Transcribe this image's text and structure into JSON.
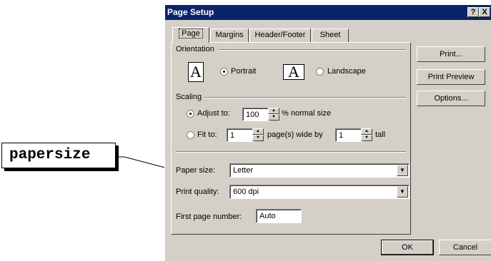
{
  "callout": {
    "text": "papersize"
  },
  "dialog": {
    "title": "Page Setup",
    "help_label": "?",
    "close_label": "X",
    "tabs": [
      "Page",
      "Margins",
      "Header/Footer",
      "Sheet"
    ],
    "active_tab": "Page",
    "orientation": {
      "label": "Orientation",
      "portrait_label": "Portrait",
      "landscape_label": "Landscape",
      "icon_glyph": "A",
      "selected": "Portrait"
    },
    "scaling": {
      "label": "Scaling",
      "adjust_label": "Adjust to:",
      "adjust_value": "100",
      "adjust_suffix": "% normal size",
      "fit_label": "Fit to:",
      "fit_wide_value": "1",
      "fit_wide_suffix": "page(s) wide by",
      "fit_tall_value": "1",
      "fit_tall_suffix": "tall",
      "selected": "Adjust to"
    },
    "paper_size": {
      "label": "Paper size:",
      "value": "Letter"
    },
    "print_quality": {
      "label": "Print quality:",
      "value": "600 dpi"
    },
    "first_page": {
      "label": "First page number:",
      "value": "Auto"
    },
    "buttons": {
      "print": "Print...",
      "print_preview": "Print Preview",
      "options": "Options...",
      "ok": "OK",
      "cancel": "Cancel"
    }
  }
}
